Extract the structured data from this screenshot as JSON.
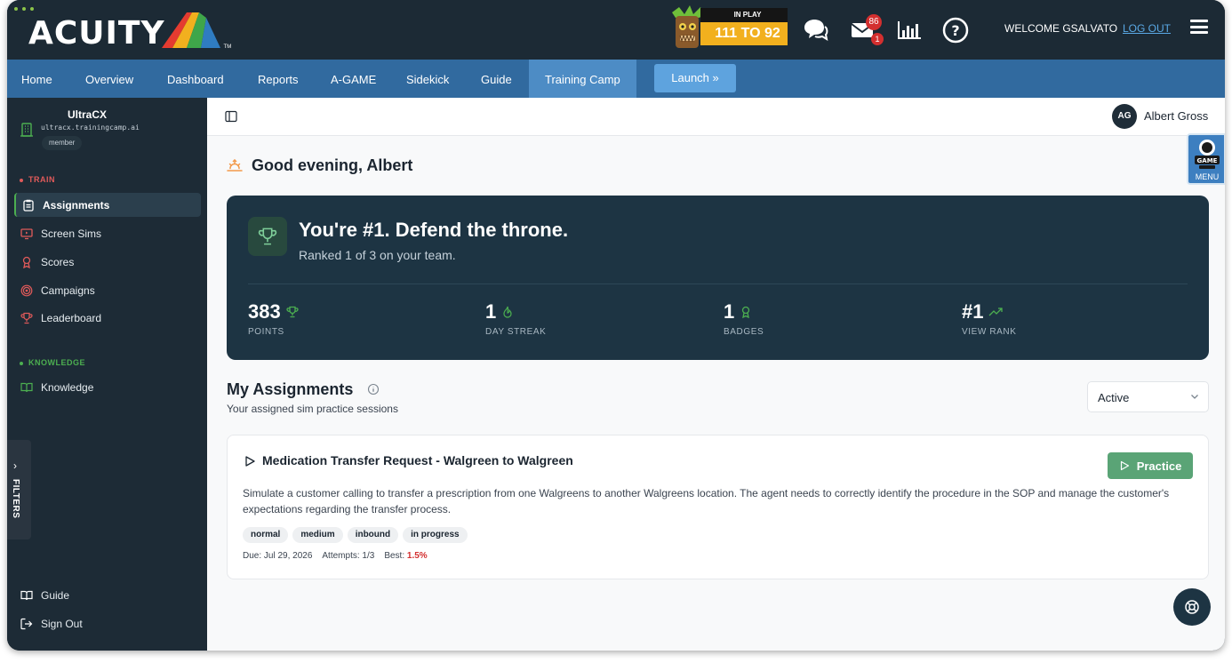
{
  "app": {
    "logo_text": "ACUITY",
    "logo_tm": "TM"
  },
  "inplay": {
    "label": "IN PLAY",
    "score": "111 TO 92"
  },
  "header": {
    "mail_count": "86",
    "alert_count": "1",
    "welcome": "WELCOME GSALVATO",
    "logout": "LOG OUT"
  },
  "nav": {
    "items": [
      "Home",
      "Overview",
      "Dashboard",
      "Reports",
      "A-GAME",
      "Sidekick",
      "Guide",
      "Training Camp"
    ],
    "active": "Training Camp",
    "launch": "Launch »"
  },
  "sidebar": {
    "org_name": "UltraCX",
    "org_domain": "ultracx.trainingcamp.ai",
    "org_role": "member",
    "train_label": "TRAIN",
    "train_items": [
      "Assignments",
      "Screen Sims",
      "Scores",
      "Campaigns",
      "Leaderboard"
    ],
    "knowledge_label": "KNOWLEDGE",
    "knowledge_items": [
      "Knowledge"
    ],
    "filters": "FILTERS",
    "bottom_items": [
      "Guide",
      "Sign Out"
    ],
    "colors": {
      "train": "#e05a5a",
      "knowledge": "#4caf50"
    }
  },
  "main": {
    "user_initials": "AG",
    "user_name": "Albert Gross",
    "game_menu_label": "MENU",
    "game_menu_badge": "GAME",
    "greeting": "Good evening, Albert",
    "hero": {
      "title": "You're #1. Defend the throne.",
      "subtitle": "Ranked 1 of 3 on your team.",
      "stats": [
        {
          "value": "383",
          "label": "POINTS",
          "icon": "trophy-icon"
        },
        {
          "value": "1",
          "label": "DAY STREAK",
          "icon": "flame-icon"
        },
        {
          "value": "1",
          "label": "BADGES",
          "icon": "award-icon"
        },
        {
          "value": "#1",
          "label": "VIEW RANK",
          "icon": "trending-up-icon"
        }
      ]
    },
    "assignments": {
      "title": "My Assignments",
      "subtitle": "Your assigned sim practice sessions",
      "filter_value": "Active",
      "card": {
        "title": "Medication Transfer Request - Walgreen to Walgreen",
        "practice": "Practice",
        "description": "Simulate a customer calling to transfer a prescription from one Walgreens to another Walgreens location. The agent needs to correctly identify the procedure in the SOP and manage the customer's expectations regarding the transfer process.",
        "tags": [
          "normal",
          "medium",
          "inbound",
          "in progress"
        ],
        "due": "Due: Jul 29, 2026",
        "attempts": "Attempts: 1/3",
        "best_label": "Best:",
        "best_value": "1.5%"
      }
    }
  }
}
